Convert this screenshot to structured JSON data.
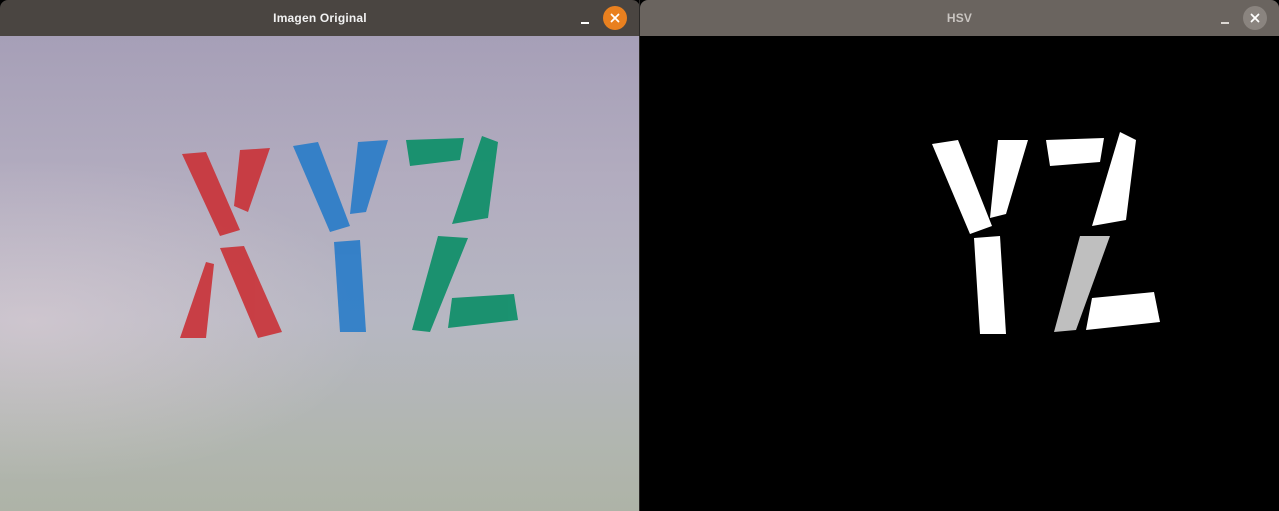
{
  "windows": [
    {
      "title": "Imagen Original",
      "content": {
        "letters": [
          "X",
          "Y",
          "Z"
        ],
        "letter_colors": {
          "X": "#c9343a",
          "Y": "#2f7ec8",
          "Z": "#13906b"
        }
      },
      "accent_close": "#e9801f",
      "icons": [
        "minimize-icon",
        "close-icon"
      ]
    },
    {
      "title": "HSV",
      "content": {
        "visible_letters": [
          "Y",
          "Z"
        ],
        "mask_color": "#ffffff",
        "background": "#000000"
      },
      "accent_close": "#8a847f",
      "icons": [
        "minimize-icon",
        "close-icon"
      ]
    }
  ]
}
